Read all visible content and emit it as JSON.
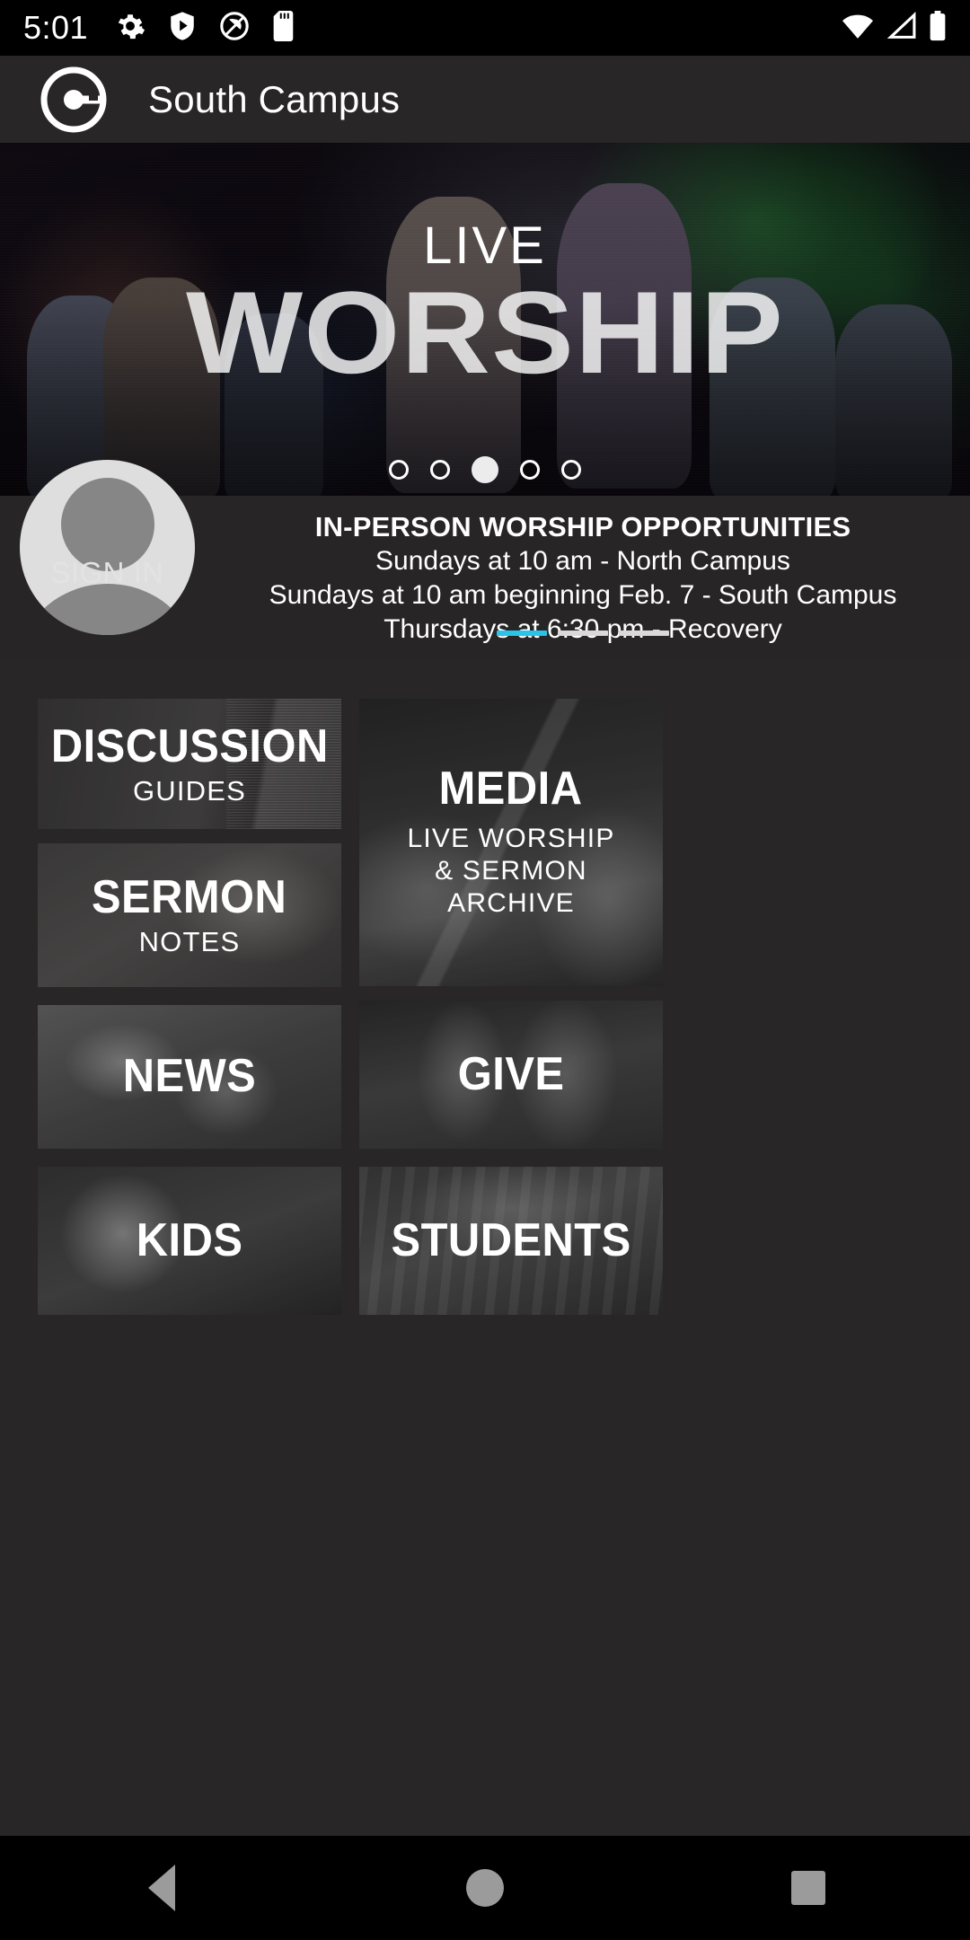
{
  "status_bar": {
    "time": "5:01",
    "left_icons": [
      "settings-icon",
      "play-protect-icon",
      "screen-record-icon",
      "sd-card-icon"
    ],
    "right_icons": [
      "wifi-icon",
      "cellular-signal-icon",
      "battery-icon"
    ]
  },
  "app_bar": {
    "logo": "church-c-logo-icon",
    "title": "South Campus"
  },
  "hero": {
    "overlay_line1": "LIVE",
    "overlay_line2": "WORSHIP",
    "slide_count": 5,
    "active_slide": 3
  },
  "announcement": {
    "avatar": "user-avatar-icon",
    "sign_in_label": "SIGN IN",
    "title": "IN-PERSON WORSHIP OPPORTUNITIES",
    "lines": [
      "Sundays at 10 am - North Campus",
      "Sundays at 10 am beginning Feb. 7 - South Campus",
      "Thursdays at 6:30 pm - Recovery"
    ],
    "bar_count": 3,
    "bar_active": 1,
    "accent_color": "#2bc4e8"
  },
  "tiles": [
    {
      "title": "DISCUSSION",
      "subtitle": "GUIDES"
    },
    {
      "title": "MEDIA",
      "subtitle": "LIVE WORSHIP\n& SERMON\nARCHIVE"
    },
    {
      "title": "SERMON",
      "subtitle": "NOTES"
    },
    {
      "title": "NEWS",
      "subtitle": ""
    },
    {
      "title": "GIVE",
      "subtitle": ""
    },
    {
      "title": "KIDS",
      "subtitle": ""
    },
    {
      "title": "STUDENTS",
      "subtitle": ""
    }
  ],
  "nav_bar": {
    "back": "back-triangle-icon",
    "home": "home-circle-icon",
    "recents": "recents-square-icon"
  }
}
